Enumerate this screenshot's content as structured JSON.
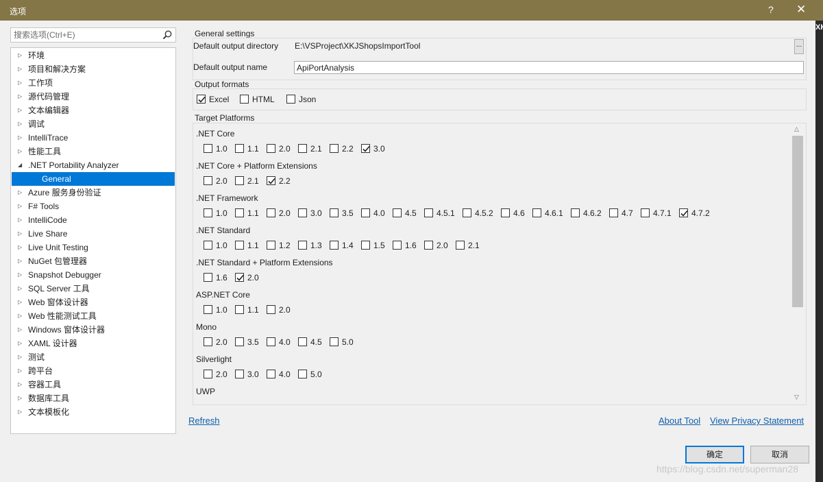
{
  "window": {
    "title": "选项",
    "help": "?",
    "close": "✕"
  },
  "background_text": "XK",
  "search": {
    "placeholder": "搜索选项(Ctrl+E)"
  },
  "tree": [
    {
      "label": "环境",
      "expanded": false
    },
    {
      "label": "项目和解决方案",
      "expanded": false
    },
    {
      "label": "工作项",
      "expanded": false
    },
    {
      "label": "源代码管理",
      "expanded": false
    },
    {
      "label": "文本编辑器",
      "expanded": false
    },
    {
      "label": "调试",
      "expanded": false
    },
    {
      "label": "IntelliTrace",
      "expanded": false
    },
    {
      "label": "性能工具",
      "expanded": false
    },
    {
      "label": ".NET Portability Analyzer",
      "expanded": true
    },
    {
      "label": "General",
      "child": true,
      "selected": true
    },
    {
      "label": "Azure 服务身份验证",
      "expanded": false
    },
    {
      "label": "F# Tools",
      "expanded": false
    },
    {
      "label": "IntelliCode",
      "expanded": false
    },
    {
      "label": "Live Share",
      "expanded": false
    },
    {
      "label": "Live Unit Testing",
      "expanded": false
    },
    {
      "label": "NuGet 包管理器",
      "expanded": false
    },
    {
      "label": "Snapshot Debugger",
      "expanded": false
    },
    {
      "label": "SQL Server 工具",
      "expanded": false
    },
    {
      "label": "Web 窗体设计器",
      "expanded": false
    },
    {
      "label": "Web 性能测试工具",
      "expanded": false
    },
    {
      "label": "Windows 窗体设计器",
      "expanded": false
    },
    {
      "label": "XAML 设计器",
      "expanded": false
    },
    {
      "label": "测试",
      "expanded": false
    },
    {
      "label": "跨平台",
      "expanded": false
    },
    {
      "label": "容器工具",
      "expanded": false
    },
    {
      "label": "数据库工具",
      "expanded": false
    },
    {
      "label": "文本模板化",
      "expanded": false
    }
  ],
  "general": {
    "title": "General settings",
    "dir_label": "Default output directory",
    "dir_value": "E:\\VSProject\\XKJShopsImportTool",
    "browse_label": "...",
    "name_label": "Default output name",
    "name_value": "ApiPortAnalysis"
  },
  "formats": {
    "title": "Output formats",
    "items": [
      {
        "label": "Excel",
        "checked": true
      },
      {
        "label": "HTML",
        "checked": false
      },
      {
        "label": "Json",
        "checked": false
      }
    ]
  },
  "platforms": {
    "title": "Target Platforms",
    "groups": [
      {
        "name": ".NET Core",
        "versions": [
          {
            "v": "1.0",
            "checked": false
          },
          {
            "v": "1.1",
            "checked": false
          },
          {
            "v": "2.0",
            "checked": false
          },
          {
            "v": "2.1",
            "checked": false
          },
          {
            "v": "2.2",
            "checked": false
          },
          {
            "v": "3.0",
            "checked": true
          }
        ]
      },
      {
        "name": ".NET Core + Platform Extensions",
        "versions": [
          {
            "v": "2.0",
            "checked": false
          },
          {
            "v": "2.1",
            "checked": false
          },
          {
            "v": "2.2",
            "checked": true
          }
        ]
      },
      {
        "name": ".NET Framework",
        "versions": [
          {
            "v": "1.0",
            "checked": false
          },
          {
            "v": "1.1",
            "checked": false
          },
          {
            "v": "2.0",
            "checked": false
          },
          {
            "v": "3.0",
            "checked": false
          },
          {
            "v": "3.5",
            "checked": false
          },
          {
            "v": "4.0",
            "checked": false
          },
          {
            "v": "4.5",
            "checked": false
          },
          {
            "v": "4.5.1",
            "checked": false
          },
          {
            "v": "4.5.2",
            "checked": false
          },
          {
            "v": "4.6",
            "checked": false
          },
          {
            "v": "4.6.1",
            "checked": false
          },
          {
            "v": "4.6.2",
            "checked": false
          },
          {
            "v": "4.7",
            "checked": false
          },
          {
            "v": "4.7.1",
            "checked": false
          },
          {
            "v": "4.7.2",
            "checked": true
          }
        ]
      },
      {
        "name": ".NET Standard",
        "versions": [
          {
            "v": "1.0",
            "checked": false
          },
          {
            "v": "1.1",
            "checked": false
          },
          {
            "v": "1.2",
            "checked": false
          },
          {
            "v": "1.3",
            "checked": false
          },
          {
            "v": "1.4",
            "checked": false
          },
          {
            "v": "1.5",
            "checked": false
          },
          {
            "v": "1.6",
            "checked": false
          },
          {
            "v": "2.0",
            "checked": false
          },
          {
            "v": "2.1",
            "checked": false
          }
        ]
      },
      {
        "name": ".NET Standard + Platform Extensions",
        "versions": [
          {
            "v": "1.6",
            "checked": false
          },
          {
            "v": "2.0",
            "checked": true
          }
        ]
      },
      {
        "name": "ASP.NET Core",
        "versions": [
          {
            "v": "1.0",
            "checked": false
          },
          {
            "v": "1.1",
            "checked": false
          },
          {
            "v": "2.0",
            "checked": false
          }
        ]
      },
      {
        "name": "Mono",
        "versions": [
          {
            "v": "2.0",
            "checked": false
          },
          {
            "v": "3.5",
            "checked": false
          },
          {
            "v": "4.0",
            "checked": false
          },
          {
            "v": "4.5",
            "checked": false
          },
          {
            "v": "5.0",
            "checked": false
          }
        ]
      },
      {
        "name": "Silverlight",
        "versions": [
          {
            "v": "2.0",
            "checked": false
          },
          {
            "v": "3.0",
            "checked": false
          },
          {
            "v": "4.0",
            "checked": false
          },
          {
            "v": "5.0",
            "checked": false
          }
        ]
      },
      {
        "name": "UWP",
        "versions": []
      }
    ]
  },
  "links": {
    "refresh": "Refresh",
    "about": "About Tool",
    "privacy": "View Privacy Statement"
  },
  "buttons": {
    "ok": "确定",
    "cancel": "取消"
  },
  "watermark": "https://blog.csdn.net/superman28"
}
